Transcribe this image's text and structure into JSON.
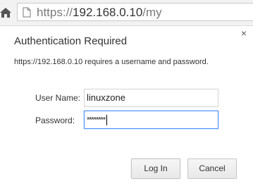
{
  "browser": {
    "url_scheme": "https://",
    "url_host": "192.168.0.10",
    "url_path": "/my"
  },
  "dialog": {
    "title": "Authentication Required",
    "message": "https://192.168.0.10 requires a username and password.",
    "close_glyph": "×",
    "username_label": "User Name:",
    "username_value": "linuxzone",
    "password_label": "Password:",
    "password_mask": "********",
    "login_label": "Log In",
    "cancel_label": "Cancel"
  },
  "icons": {
    "home": "home-icon",
    "page": "page-icon",
    "close": "close-icon"
  },
  "colors": {
    "focus_border": "#4d90fe",
    "toolbar_bg": "#f2f2f2"
  }
}
